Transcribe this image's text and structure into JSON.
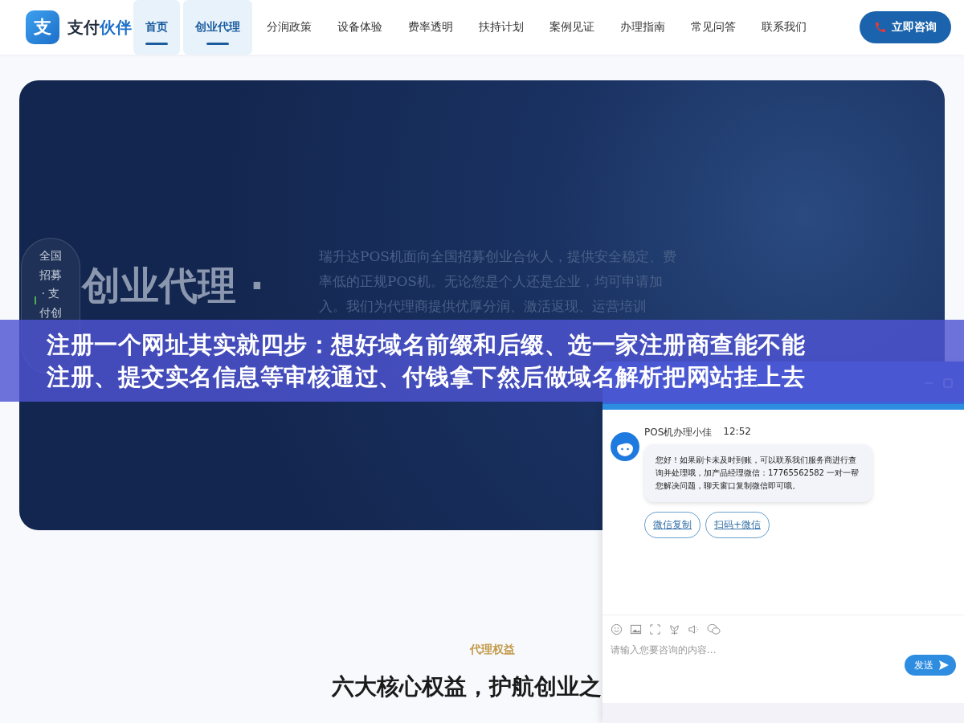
{
  "nav": {
    "logo_mark": "支",
    "logo_text": "支付",
    "logo_accent": "伙伴",
    "items": [
      {
        "label": "首页",
        "selected": true
      },
      {
        "label": "创业代理",
        "selected": true
      },
      {
        "label": "分润政策",
        "selected": false
      },
      {
        "label": "设备体验",
        "selected": false
      },
      {
        "label": "费率透明",
        "selected": false
      },
      {
        "label": "扶持计划",
        "selected": false
      },
      {
        "label": "案例见证",
        "selected": false
      },
      {
        "label": "办理指南",
        "selected": false
      },
      {
        "label": "常见问答",
        "selected": false
      },
      {
        "label": "联系我们",
        "selected": false
      }
    ],
    "cta": "立即咨询"
  },
  "hero": {
    "badge": "全国招募 · 支付创",
    "title": "创业代理 ·",
    "description": "瑞升达POS机面向全国招募创业合伙人，提供安全稳定、费率低的正规POS机。无论您是个人还是企业，均可申请加入。我们为代理商提供优厚分润、激活返现、运营培训"
  },
  "section": {
    "eyebrow": "代理权益",
    "heading": "六大核心权益，护航创业之"
  },
  "chat": {
    "agent": "POS机办理小佳",
    "time": "12:52",
    "message": "您好！如果刷卡未及时到账，可以联系我们服务商进行查询并处理哦，加产品经理微信：17765562582 一对一帮您解决问题，聊天窗口复制微信即可哦。",
    "actions": [
      "微信复制",
      "扫码+微信"
    ],
    "placeholder": "请输入您要咨询的内容...",
    "send": "发送"
  },
  "overlay_caption": {
    "lines": [
      "注册一个网址其实就四步：想好域名前缀和后缀、选一家注册商查能不能",
      "注册、提交实名信息等审核通过、付钱拿下然后做域名解析把网站挂上去"
    ]
  }
}
